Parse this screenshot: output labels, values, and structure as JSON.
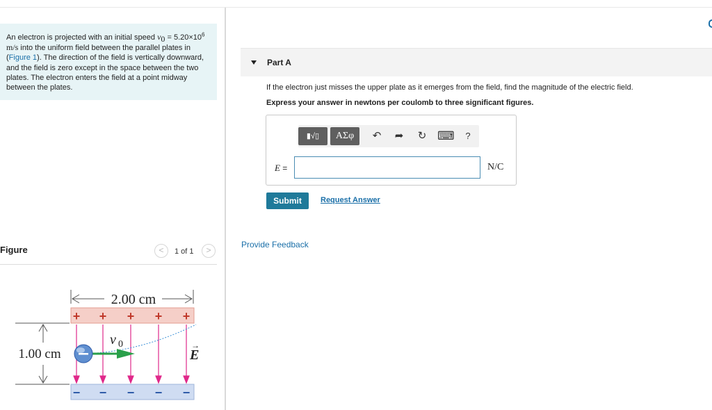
{
  "problem": {
    "text_part1": "An electron is projected with an initial speed ",
    "v0_symbol": "v",
    "v0_subscript": "0",
    "eq_sign": " =",
    "speed_mantissa": "5.20×10",
    "speed_exponent": "6",
    "speed_units": " m/s",
    "text_part2": " into the uniform field between the parallel plates in (",
    "figure_link": "Figure 1",
    "text_part3": "). The direction of the field is vertically downward, and the field is zero except in the space between the two plates. The electron enters the field at a point midway between the plates."
  },
  "figure_panel": {
    "title": "Figure",
    "prev_label": "<",
    "next_label": ">",
    "count": "1 of 1",
    "width_label": "2.00 cm",
    "height_label": "1.00 cm",
    "v0_label": "v",
    "v0_sub": "0",
    "field_label": "E",
    "field_arrow": "→",
    "plus_sign": "+",
    "minus_sign": "−"
  },
  "part": {
    "title": "Part A",
    "question": "If the electron just misses the upper plate as it emerges from the field, find the magnitude of the electric field.",
    "instruction": "Express your answer in newtons per coulomb to three significant figures."
  },
  "toolbar": {
    "template_label": "▮√▯",
    "greek_label": "ΑΣφ",
    "undo_icon": "↶",
    "redo_icon": "➦",
    "reset_icon": "↻",
    "keyboard_icon": "⌨",
    "help_label": "?"
  },
  "answer": {
    "variable": "E",
    "equals": " =",
    "value": "",
    "units": "N/C"
  },
  "actions": {
    "submit": "Submit",
    "request": "Request Answer",
    "feedback": "Provide Feedback"
  },
  "colors": {
    "accent": "#1f7a9a",
    "link": "#1a6fa8",
    "problem_bg": "#e7f4f6",
    "plate_positive": "#f5cfc8",
    "plate_negative": "#cfdcf2",
    "field_lines": "#e0288a",
    "velocity_arrow": "#2aa04a"
  }
}
